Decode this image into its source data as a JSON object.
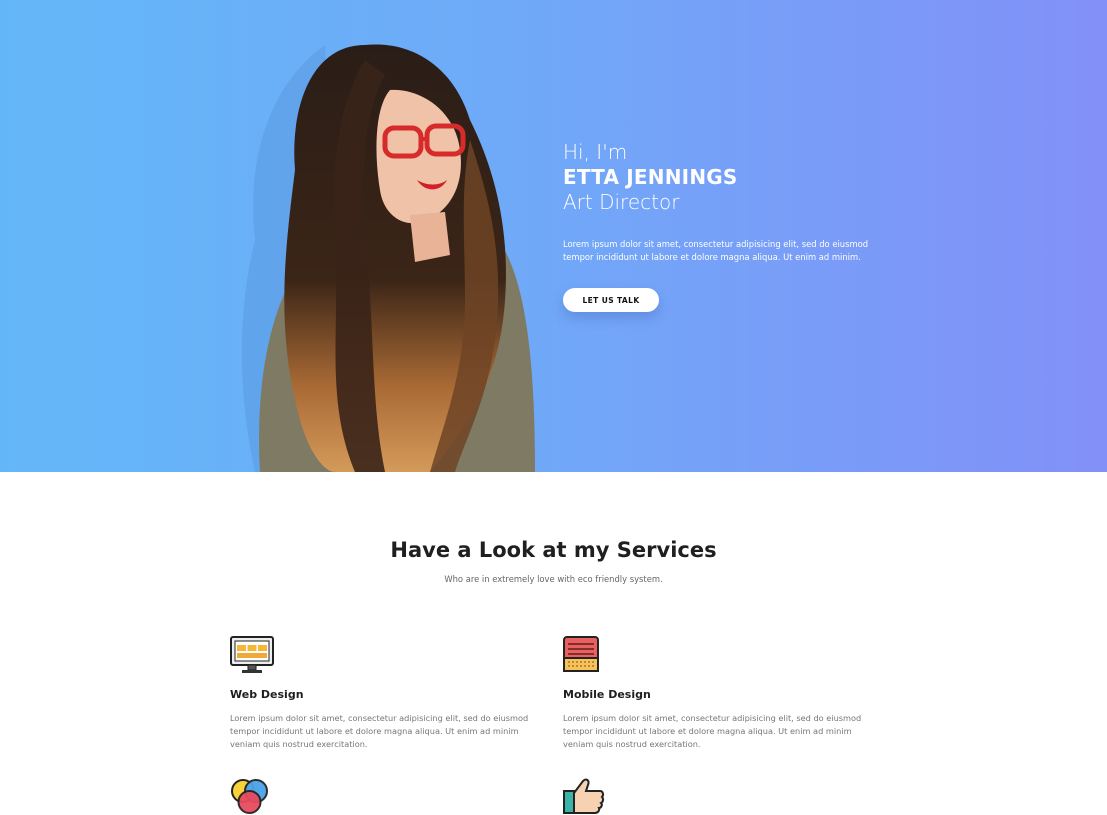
{
  "hero": {
    "greeting": "Hi, I'm",
    "name": "ETTA JENNINGS",
    "role": "Art Director",
    "intro": "Lorem ipsum dolor sit amet, consectetur adipisicing elit, sed do eiusmod tempor incididunt ut labore et dolore magna aliqua. Ut enim ad minim.",
    "cta_label": "LET US TALK"
  },
  "services": {
    "title": "Have a Look at my Services",
    "subtitle": "Who are in extremely love with eco friendly system.",
    "items": [
      {
        "title": "Web Design",
        "description": "Lorem ipsum dolor sit amet, consectetur adipisicing elit, sed do eiusmod tempor incididunt ut labore et dolore magna aliqua. Ut enim ad minim veniam quis nostrud exercitation.",
        "icon": "monitor-icon"
      },
      {
        "title": "Mobile Design",
        "description": "Lorem ipsum dolor sit amet, consectetur adipisicing elit, sed do eiusmod tempor incididunt ut labore et dolore magna aliqua. Ut enim ad minim veniam quis nostrud exercitation.",
        "icon": "keyboard-icon"
      },
      {
        "title": "",
        "description": "",
        "icon": "color-wheel-icon"
      },
      {
        "title": "",
        "description": "",
        "icon": "thumbs-up-icon"
      }
    ]
  },
  "colors": {
    "gradient_start": "#63b7f9",
    "gradient_end": "#8290f8",
    "text_on_hero": "#ffffff"
  }
}
